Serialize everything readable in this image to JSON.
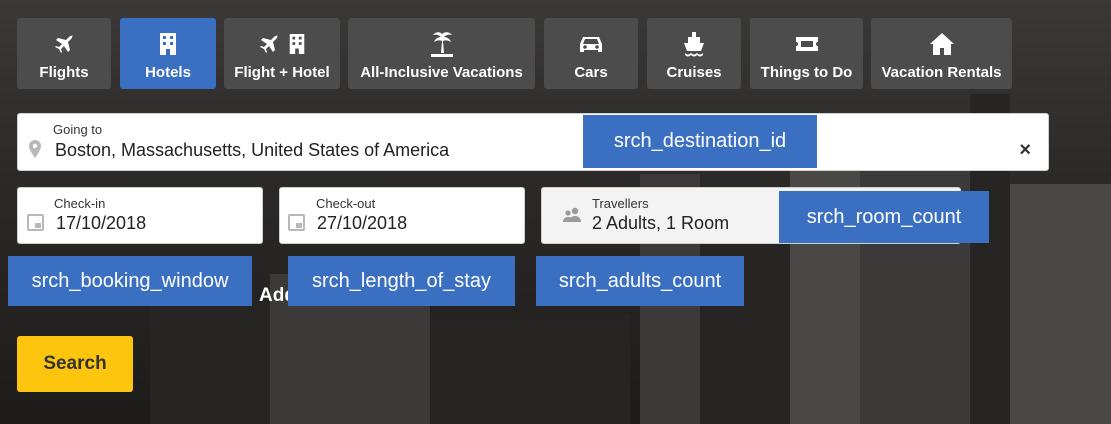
{
  "tabs": [
    {
      "label": "Flights",
      "icon": "airplane-icon"
    },
    {
      "label": "Hotels",
      "icon": "hotel-building-icon"
    },
    {
      "label": "Flight + Hotel",
      "icon": "flight-hotel-icon"
    },
    {
      "label": "All-Inclusive Vacations",
      "icon": "palm-island-icon"
    },
    {
      "label": "Cars",
      "icon": "car-icon"
    },
    {
      "label": "Cruises",
      "icon": "cruise-ship-icon"
    },
    {
      "label": "Things to Do",
      "icon": "ticket-icon"
    },
    {
      "label": "Vacation Rentals",
      "icon": "house-icon"
    }
  ],
  "active_tab": "Hotels",
  "destination": {
    "label": "Going to",
    "value": "Boston, Massachusetts, United States of America",
    "clear": "×"
  },
  "checkin": {
    "label": "Check-in",
    "value": "17/10/2018"
  },
  "checkout": {
    "label": "Check-out",
    "value": "27/10/2018"
  },
  "travellers": {
    "label": "Travellers",
    "value": "2 Adults, 1 Room"
  },
  "annotations": {
    "destination_id": "srch_destination_id",
    "room_count": "srch_room_count",
    "booking_window": "srch_booking_window",
    "length_of_stay": "srch_length_of_stay",
    "adults_count": "srch_adults_count"
  },
  "partial_text": "Add",
  "search_label": "Search",
  "colors": {
    "accent": "#3b6fc2",
    "tab": "#4c4c4c",
    "search": "#fec50f"
  }
}
